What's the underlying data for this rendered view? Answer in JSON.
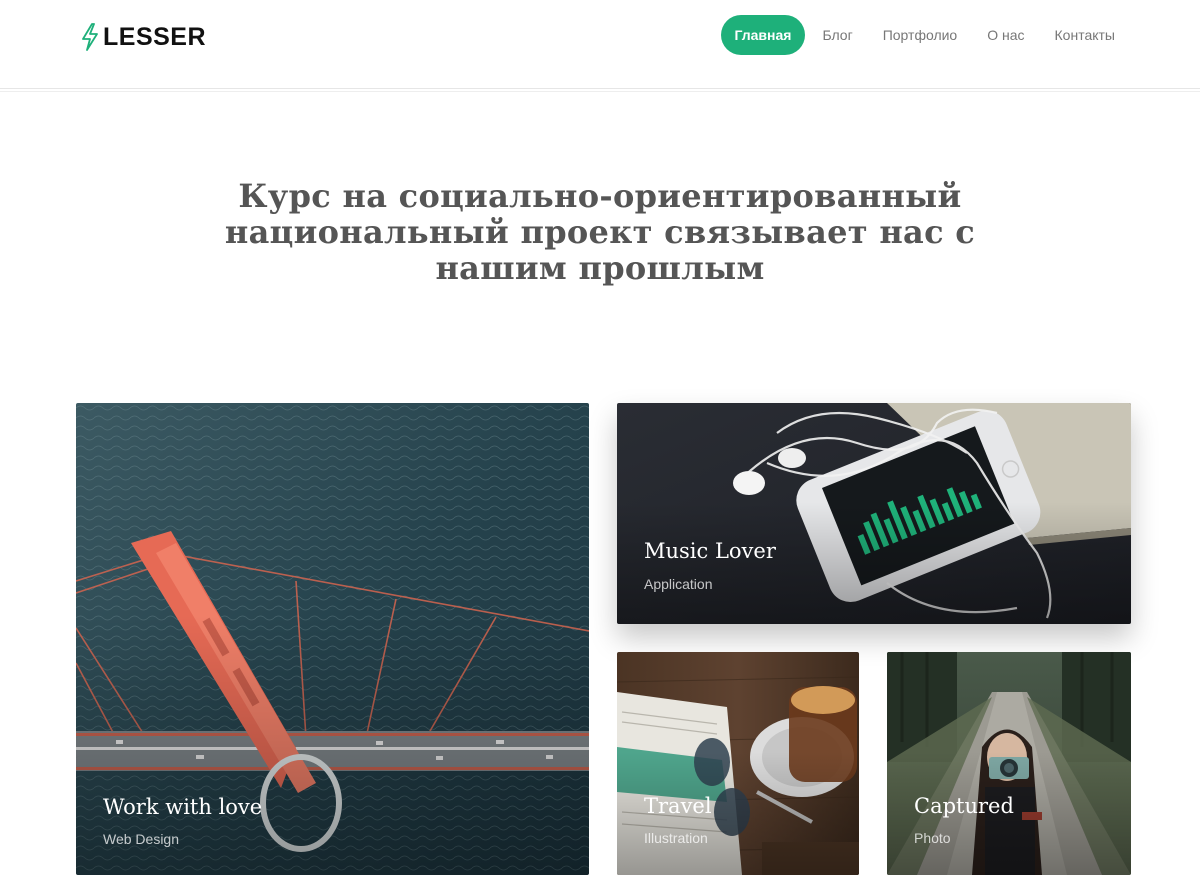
{
  "brand": {
    "name": "LESSER",
    "icon": "bolt-icon",
    "accent": "#1eb07a"
  },
  "nav": {
    "items": [
      {
        "label": "Главная",
        "active": true
      },
      {
        "label": "Блог",
        "active": false
      },
      {
        "label": "Портфолио",
        "active": false
      },
      {
        "label": "О нас",
        "active": false
      },
      {
        "label": "Контакты",
        "active": false
      }
    ]
  },
  "hero": {
    "line1": "Курс на социально-ориентированный",
    "line2": "национальный проект связывает нас с",
    "line3": "нашим прошлым"
  },
  "portfolio": [
    {
      "title": "Work with love",
      "category": "Web Design",
      "image": "bridge-over-water"
    },
    {
      "title": "Music Lover",
      "category": "Application",
      "image": "phone-with-earphones"
    },
    {
      "title": "Travel",
      "category": "Illustration",
      "image": "coffee-and-newspaper"
    },
    {
      "title": "Captured",
      "category": "Photo",
      "image": "woman-with-camera"
    }
  ]
}
